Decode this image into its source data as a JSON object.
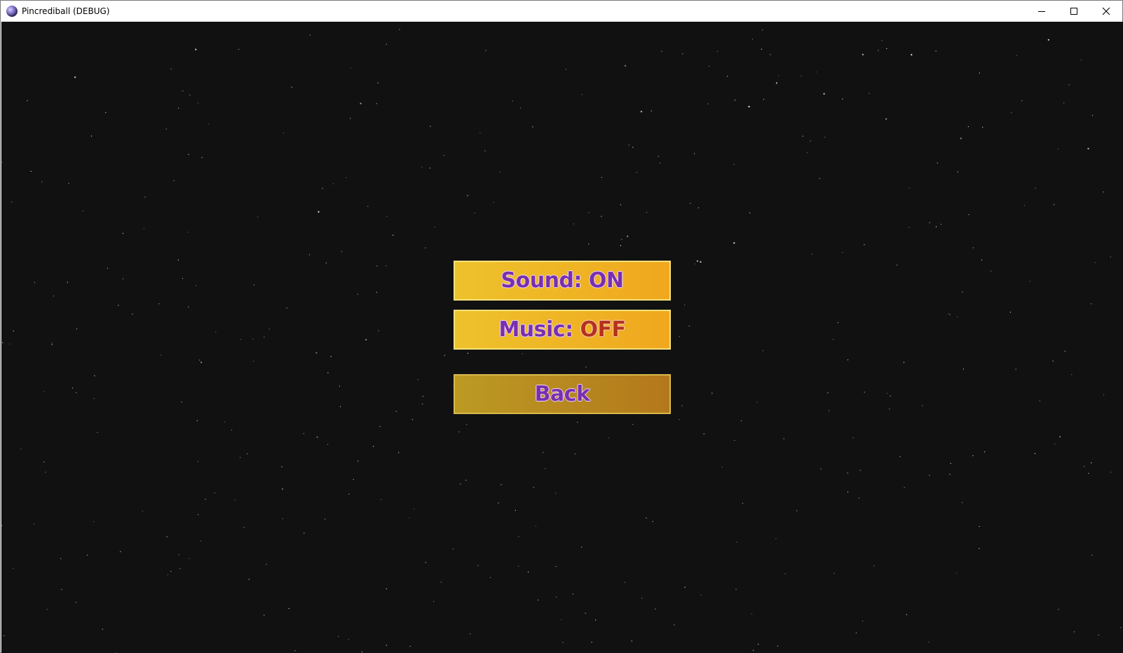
{
  "window": {
    "title": "Pincrediball (DEBUG)",
    "app_icon": "pinball-ball-icon",
    "controls": {
      "minimize_icon": "minimize-icon",
      "maximize_icon": "maximize-icon",
      "close_icon": "close-icon"
    }
  },
  "menu": {
    "sound": {
      "label": "Sound:",
      "value": "ON"
    },
    "music": {
      "label": "Music:",
      "value": "OFF"
    },
    "back": {
      "label": "Back"
    }
  },
  "colors": {
    "background": "#111111",
    "button_gradient_start": "#eec22c",
    "button_gradient_end": "#f0a71e",
    "label_purple": "#7a2fae",
    "off_red": "#b5321c",
    "back_button_start": "#bb9a23",
    "back_button_end": "#b4781c"
  }
}
